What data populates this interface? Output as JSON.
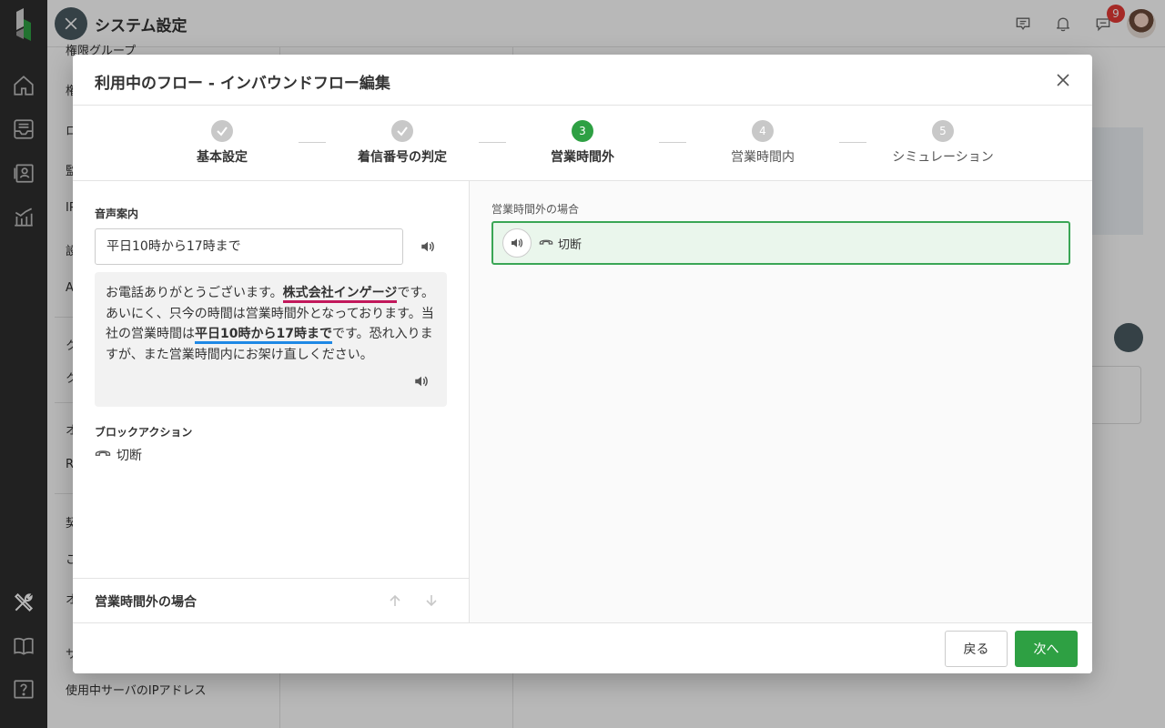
{
  "app": {
    "title": "システム設定",
    "notification_badge": "9"
  },
  "rail": {
    "icons": [
      "home-icon",
      "inbox-icon",
      "contacts-icon",
      "analytics-icon",
      "tools-icon",
      "book-icon",
      "help-icon"
    ]
  },
  "subnav": {
    "items": [
      "権限グループ",
      "権",
      "ロ",
      "監",
      "IP",
      "設",
      "A",
      "ク",
      "ク",
      "オ",
      "R",
      "契",
      "こ",
      "オ",
      "サ",
      "使用中サーバのIPアドレス"
    ]
  },
  "modal": {
    "title": "利用中のフロー - インバウンドフロー編集",
    "steps": [
      {
        "number": "1",
        "label": "基本設定",
        "state": "done"
      },
      {
        "number": "2",
        "label": "着信番号の判定",
        "state": "done"
      },
      {
        "number": "3",
        "label": "営業時間外",
        "state": "active"
      },
      {
        "number": "4",
        "label": "営業時間内",
        "state": "pending"
      },
      {
        "number": "5",
        "label": "シミュレーション",
        "state": "pending"
      }
    ],
    "left": {
      "voice_label": "音声案内",
      "voice_select_value": "平日10時から17時まで",
      "message": {
        "part1": "お電話ありがとうございます。",
        "company": "株式会社インゲージ",
        "part2": "です。あいにく、只今の時間は営業時間外となっております。当社の営業時間は",
        "hours": "平日10時から17時まで",
        "part3": "です。恐れ入りますが、また営業時間内にお架け直しください。"
      },
      "block_action_label": "ブロックアクション",
      "block_action_value": "切断",
      "footer_title": "営業時間外の場合"
    },
    "right": {
      "caption": "営業時間外の場合",
      "action_label": "切断"
    },
    "buttons": {
      "back": "戻る",
      "next": "次へ"
    }
  },
  "colors": {
    "accent_green": "#2ea043",
    "rail_dark": "#2f2f2f",
    "highlight_red": "#c2185b",
    "highlight_blue": "#1e88e5"
  }
}
